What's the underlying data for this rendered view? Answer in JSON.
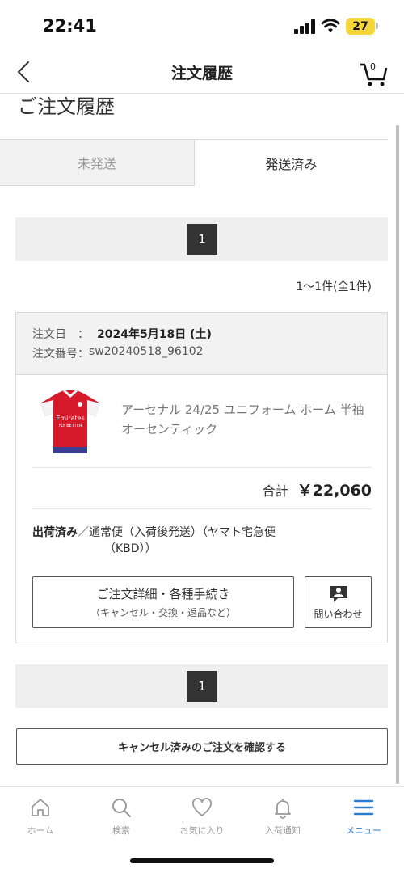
{
  "status_bar": {
    "time": "22:41",
    "battery": "27"
  },
  "header": {
    "title": "注文履歴",
    "cart_count": "0"
  },
  "page_title": "ご注文履歴",
  "tabs": [
    {
      "label": "未発送",
      "active": false
    },
    {
      "label": "発送済み",
      "active": true
    }
  ],
  "pagination": {
    "current_page": "1",
    "range_text": "1～1件(全1件)"
  },
  "order": {
    "date_label": "注文日　：",
    "date_value": "2024年5月18日 (土)",
    "number_label": "注文番号：",
    "number_value": "sw20240518_96102",
    "product_name": "アーセナル 24/25 ユニフォーム ホーム 半袖 オーセンティック",
    "product_image_text": "Emirates FLY BETTER",
    "total_label": "合計",
    "total_value": "￥22,060",
    "ship_status": "出荷済み",
    "ship_method_line1": "／通常便（入荷後発送）（ヤマト宅急便",
    "ship_method_line2": "（KBD））",
    "detail_button_main": "ご注文詳細・各種手続き",
    "detail_button_sub": "（キャンセル・交換・返品など）",
    "inquiry_button_label": "問い合わせ"
  },
  "cancelled_button": "キャンセル済みのご注文を確認する",
  "bottom_nav": [
    {
      "label": "ホーム",
      "icon": "home-icon",
      "active": false
    },
    {
      "label": "検索",
      "icon": "search-icon",
      "active": false
    },
    {
      "label": "お気に入り",
      "icon": "heart-icon",
      "active": false
    },
    {
      "label": "入荷通知",
      "icon": "bell-icon",
      "active": false
    },
    {
      "label": "メニュー",
      "icon": "menu-icon",
      "active": true
    }
  ],
  "colors": {
    "accent": "#2b7bd3",
    "pager_active": "#333333",
    "battery": "#f5d53c",
    "jersey_red": "#d6192b"
  }
}
